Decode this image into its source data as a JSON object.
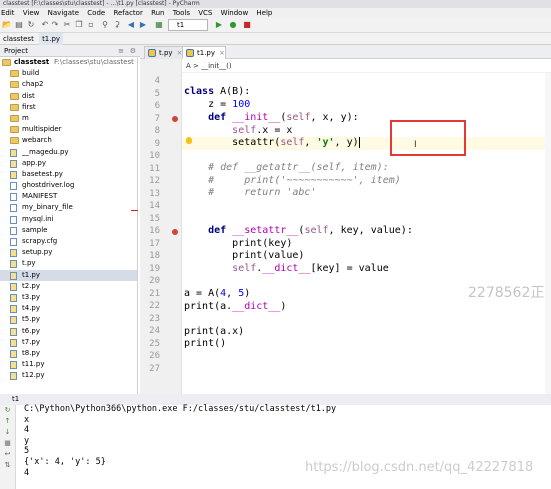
{
  "window": {
    "title": "classtest [F:\\classes\\stu\\classtest] - ...\\t1.py [classtest] - PyCharm"
  },
  "menu": [
    "Edit",
    "View",
    "Navigate",
    "Code",
    "Refactor",
    "Run",
    "Tools",
    "VCS",
    "Window",
    "Help"
  ],
  "toolbar": {
    "run_config": "t1",
    "icons": [
      "open-icon",
      "save-icon",
      "sync-icon",
      "undo-icon",
      "redo-icon",
      "cut-icon",
      "copy-icon",
      "paste-icon",
      "find-icon",
      "replace-icon",
      "back-icon",
      "forward-icon",
      "build-icon",
      "run-icon",
      "debug-icon",
      "stop-icon"
    ]
  },
  "navbar": {
    "crumbs": [
      "classtest",
      "t1.py"
    ]
  },
  "project": {
    "header": "Project",
    "root": "classtest",
    "root_path": "F:\\classes\\stu\\classtest",
    "items": [
      {
        "label": "build",
        "kind": "folder"
      },
      {
        "label": "chap2",
        "kind": "folder"
      },
      {
        "label": "dist",
        "kind": "folder"
      },
      {
        "label": "first",
        "kind": "folder"
      },
      {
        "label": "m",
        "kind": "folder"
      },
      {
        "label": "multispider",
        "kind": "folder"
      },
      {
        "label": "webarch",
        "kind": "folder"
      },
      {
        "label": "__magedu.py",
        "kind": "py"
      },
      {
        "label": "app.py",
        "kind": "py"
      },
      {
        "label": "basetest.py",
        "kind": "py"
      },
      {
        "label": "ghostdriver.log",
        "kind": "file"
      },
      {
        "label": "MANIFEST",
        "kind": "file"
      },
      {
        "label": "my_binary_file",
        "kind": "file"
      },
      {
        "label": "mysql.ini",
        "kind": "file"
      },
      {
        "label": "sample",
        "kind": "file"
      },
      {
        "label": "scrapy.cfg",
        "kind": "file"
      },
      {
        "label": "setup.py",
        "kind": "py"
      },
      {
        "label": "t.py",
        "kind": "py"
      },
      {
        "label": "t1.py",
        "kind": "py",
        "selected": true
      },
      {
        "label": "t2.py",
        "kind": "py"
      },
      {
        "label": "t3.py",
        "kind": "py"
      },
      {
        "label": "t4.py",
        "kind": "py"
      },
      {
        "label": "t5.py",
        "kind": "py"
      },
      {
        "label": "t6.py",
        "kind": "py"
      },
      {
        "label": "t7.py",
        "kind": "py"
      },
      {
        "label": "t8.py",
        "kind": "py"
      },
      {
        "label": "t11.py",
        "kind": "py"
      },
      {
        "label": "t12.py",
        "kind": "py"
      }
    ]
  },
  "tabs": [
    {
      "label": "t.py",
      "active": false
    },
    {
      "label": "t1.py",
      "active": true
    }
  ],
  "editor": {
    "breadcrumb": "A  >  __init__()",
    "line_numbers": [
      "4",
      "5",
      "6",
      "7",
      "8",
      "9",
      "10",
      "11",
      "12",
      "13",
      "14",
      "15",
      "16",
      "17",
      "18",
      "19",
      "20",
      "21",
      "22",
      "23",
      "24",
      "25",
      "26",
      "27"
    ]
  },
  "run": {
    "tab_label": "t1",
    "output": [
      "C:\\Python\\Python366\\python.exe F:/classes/stu/classtest/t1.py",
      "x",
      "4",
      "y",
      "5",
      "{'x': 4, 'y': 5}",
      "4"
    ]
  },
  "watermarks": {
    "editor": "2278562正",
    "console": "https://blog.csdn.net/qq_42227818"
  },
  "colors": {
    "annotation_box": "#e53935",
    "keyword": "#000080",
    "string": "#008000",
    "self": "#94558d",
    "comment": "#808080"
  }
}
